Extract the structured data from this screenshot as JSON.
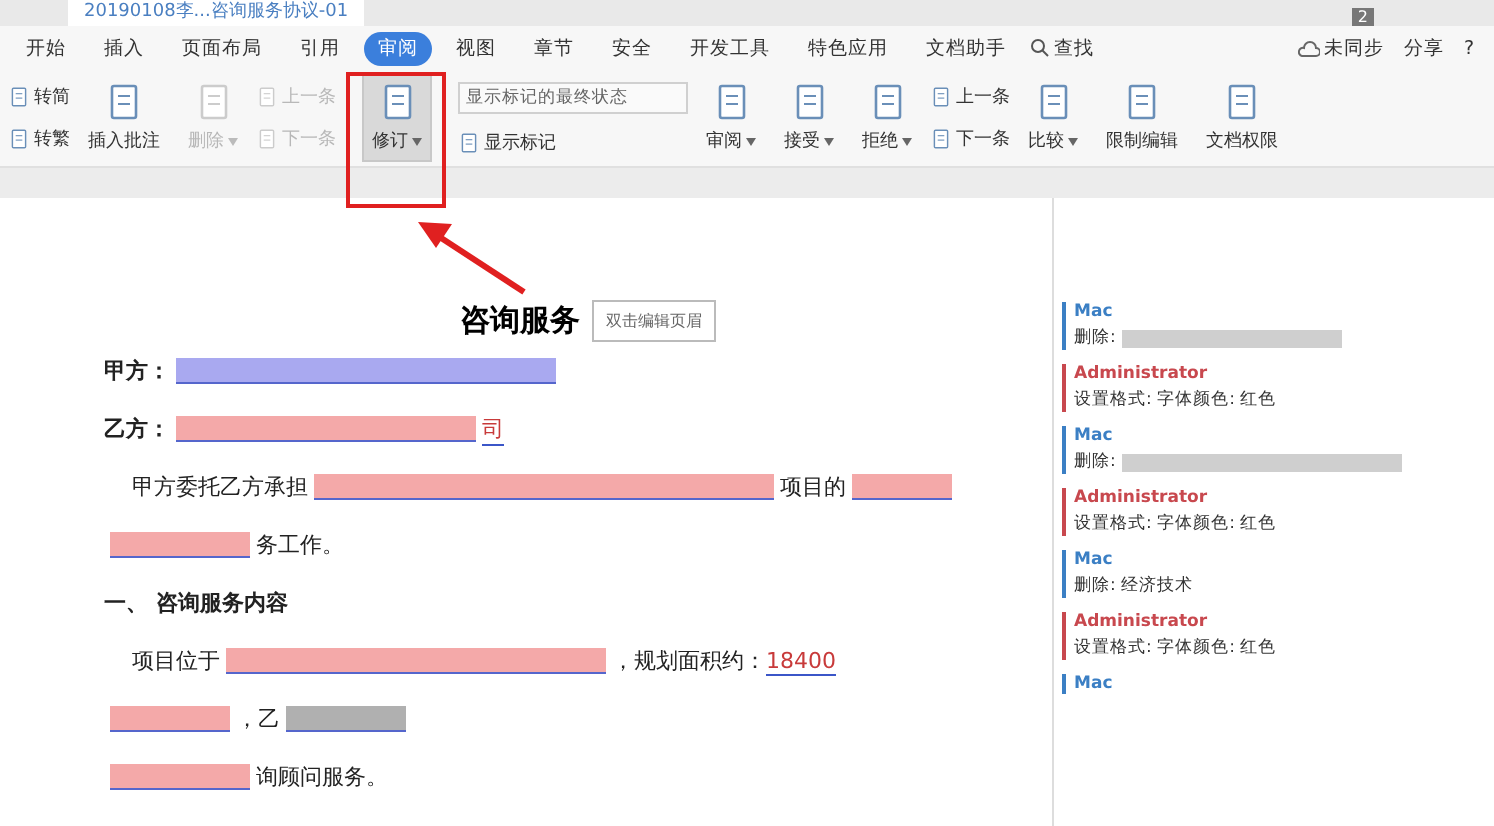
{
  "title_bar": {
    "document_tab": "20190108李...咨询服务协议-01",
    "count_badge": "2"
  },
  "menu_tabs": [
    {
      "label": "开始",
      "selected": false
    },
    {
      "label": "插入",
      "selected": false
    },
    {
      "label": "页面布局",
      "selected": false
    },
    {
      "label": "引用",
      "selected": false
    },
    {
      "label": "审阅",
      "selected": true
    },
    {
      "label": "视图",
      "selected": false
    },
    {
      "label": "章节",
      "selected": false
    },
    {
      "label": "安全",
      "selected": false
    },
    {
      "label": "开发工具",
      "selected": false
    },
    {
      "label": "特色应用",
      "selected": false
    },
    {
      "label": "文档助手",
      "selected": false
    }
  ],
  "search": {
    "label": "查找"
  },
  "menu_right": {
    "sync": "未同步",
    "share": "分享",
    "help": "?"
  },
  "ribbon": [
    {
      "kind": "pair",
      "items": [
        {
          "label": "转简",
          "disabled": false
        },
        {
          "label": "转繁",
          "disabled": false
        }
      ]
    },
    {
      "kind": "big",
      "label": "插入批注",
      "disabled": false,
      "pressed": false
    },
    {
      "kind": "big",
      "label": "删除",
      "disabled": true,
      "pressed": false,
      "dropdown": true
    },
    {
      "kind": "pair",
      "items": [
        {
          "label": "上一条",
          "disabled": true
        },
        {
          "label": "下一条",
          "disabled": true
        }
      ]
    },
    {
      "kind": "big",
      "label": "修订",
      "disabled": false,
      "pressed": true,
      "dropdown": true
    },
    {
      "kind": "display",
      "select": "显示标记的最终状态",
      "label": "显示标记"
    },
    {
      "kind": "big",
      "label": "审阅",
      "disabled": false,
      "pressed": false,
      "dropdown": true
    },
    {
      "kind": "big",
      "label": "接受",
      "disabled": false,
      "pressed": false,
      "dropdown": true
    },
    {
      "kind": "big",
      "label": "拒绝",
      "disabled": false,
      "pressed": false,
      "dropdown": true
    },
    {
      "kind": "pair",
      "items": [
        {
          "label": "上一条",
          "disabled": false
        },
        {
          "label": "下一条",
          "disabled": false
        }
      ]
    },
    {
      "kind": "big",
      "label": "比较",
      "disabled": false,
      "pressed": false,
      "dropdown": true
    },
    {
      "kind": "big",
      "label": "限制编辑",
      "disabled": false,
      "pressed": false
    },
    {
      "kind": "big",
      "label": "文档权限",
      "disabled": false,
      "pressed": false
    }
  ],
  "document": {
    "title": "咨询服务",
    "header_tooltip": "双击编辑页眉",
    "lines": [
      {
        "kind": "party",
        "segments": [
          {
            "kind": "bold",
            "text": "甲方："
          },
          {
            "kind": "redacted",
            "color": "#a9a9f0"
          }
        ]
      },
      {
        "kind": "party",
        "segments": [
          {
            "kind": "bold",
            "text": "乙方："
          },
          {
            "kind": "redacted",
            "color": "#f4a9a9"
          },
          {
            "kind": "insert",
            "text": "司"
          }
        ]
      },
      {
        "kind": "indent",
        "segments": [
          {
            "kind": "text",
            "text": "甲方委托乙方承担"
          },
          {
            "kind": "redacted",
            "color": "#f4a9a9"
          },
          {
            "kind": "text",
            "text": "项目的"
          },
          {
            "kind": "redacted",
            "color": "#f4a9a9"
          }
        ]
      },
      {
        "kind": "plain",
        "segments": [
          {
            "kind": "redacted",
            "color": "#f4a9a9"
          },
          {
            "kind": "text",
            "text": "务工作。"
          }
        ]
      },
      {
        "kind": "heading",
        "segments": [
          {
            "kind": "bold",
            "text": "一、 咨询服务内容"
          }
        ]
      },
      {
        "kind": "indent",
        "segments": [
          {
            "kind": "text",
            "text": "项目位于"
          },
          {
            "kind": "redacted",
            "color": "#f4a9a9"
          },
          {
            "kind": "text",
            "text": "，规划面积约："
          },
          {
            "kind": "insert",
            "text": "18400"
          }
        ]
      },
      {
        "kind": "plain",
        "segments": [
          {
            "kind": "redacted",
            "color": "#f4a9a9"
          },
          {
            "kind": "text",
            "text": "，乙"
          },
          {
            "kind": "redacted",
            "color": "#b0b0b0"
          }
        ]
      },
      {
        "kind": "plain",
        "segments": [
          {
            "kind": "redacted",
            "color": "#f4a9a9"
          },
          {
            "kind": "text",
            "text": "询顾问服务。"
          }
        ]
      }
    ]
  },
  "comments": [
    {
      "author": "Mac",
      "color": "#3b7fc4",
      "text": "删除:",
      "redacted": true
    },
    {
      "author": "Administrator",
      "color": "#c8484e",
      "text": "设置格式: 字体颜色: 红色",
      "redacted": false
    },
    {
      "author": "Mac",
      "color": "#3b7fc4",
      "text": "删除:",
      "redacted": true
    },
    {
      "author": "Administrator",
      "color": "#c8484e",
      "text": "设置格式: 字体颜色: 红色",
      "redacted": false
    },
    {
      "author": "Mac",
      "color": "#3b7fc4",
      "text": "删除: 经济技术",
      "redacted": false
    },
    {
      "author": "Administrator",
      "color": "#c8484e",
      "text": "设置格式: 字体颜色: 红色",
      "redacted": false
    },
    {
      "author": "Mac",
      "color": "#3b7fc4"
    }
  ]
}
